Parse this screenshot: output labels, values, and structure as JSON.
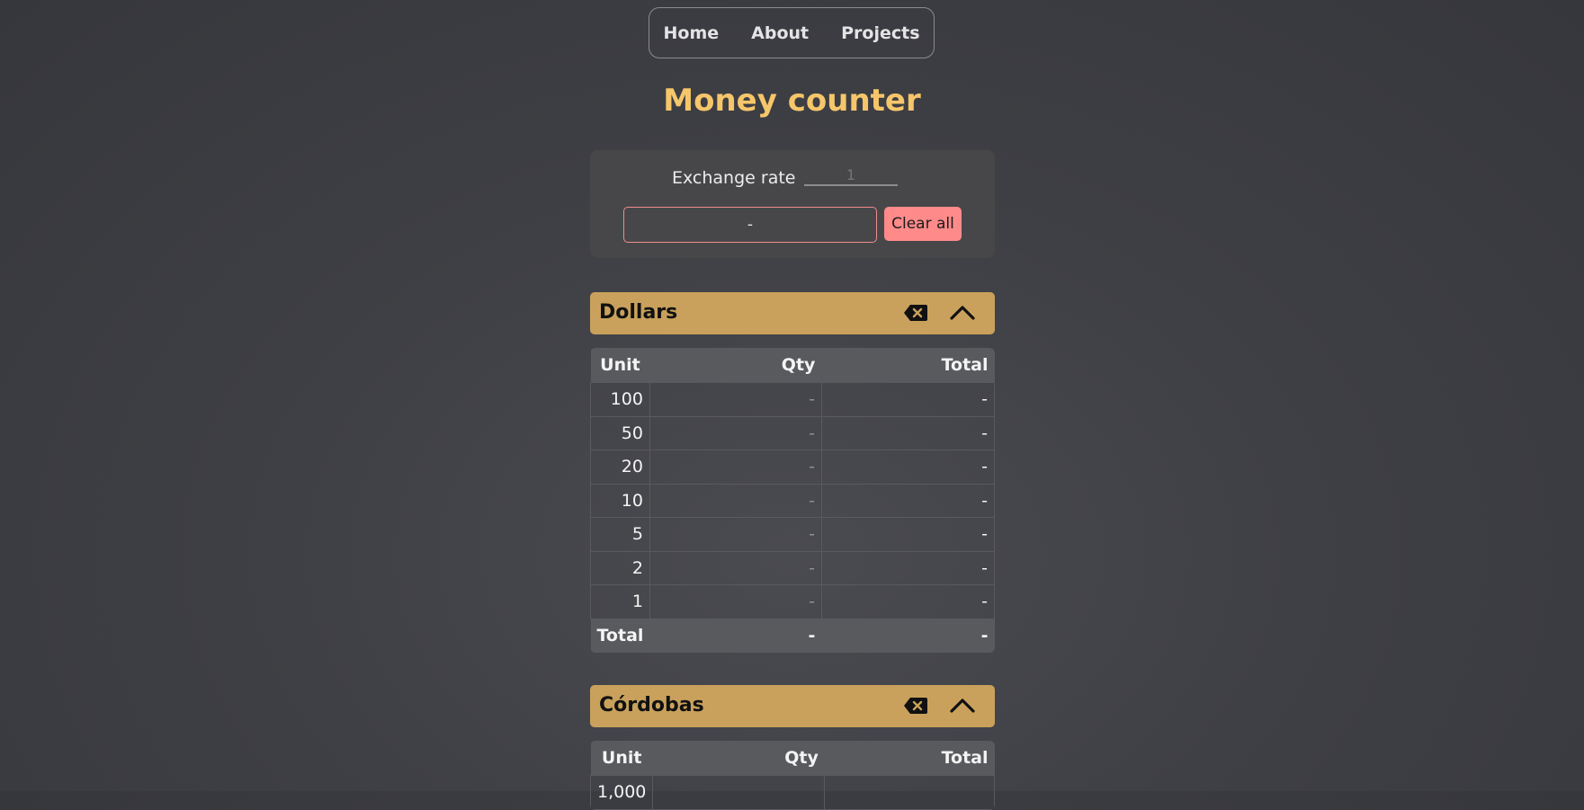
{
  "nav": {
    "items": [
      "Home",
      "About",
      "Projects"
    ]
  },
  "title": "Money counter",
  "exchange": {
    "label": "Exchange rate",
    "value": "1"
  },
  "grand_total": "-",
  "clear_all_label": "Clear all",
  "icons": {
    "clear_section": "backspace-clear-icon",
    "collapse": "chevron-up-icon"
  },
  "colors": {
    "accent": "#f6c66a",
    "section": "#c9a15c",
    "danger": "#ff8a8a"
  },
  "sections": [
    {
      "name": "Dollars",
      "headers": [
        "Unit",
        "Qty",
        "Total"
      ],
      "rows": [
        {
          "unit": "100",
          "qty": "-",
          "total": "-"
        },
        {
          "unit": "50",
          "qty": "-",
          "total": "-"
        },
        {
          "unit": "20",
          "qty": "-",
          "total": "-"
        },
        {
          "unit": "10",
          "qty": "-",
          "total": "-"
        },
        {
          "unit": "5",
          "qty": "-",
          "total": "-"
        },
        {
          "unit": "2",
          "qty": "-",
          "total": "-"
        },
        {
          "unit": "1",
          "qty": "-",
          "total": "-"
        }
      ],
      "footer": {
        "label": "Total",
        "qty": "-",
        "total": "-"
      }
    },
    {
      "name": "Córdobas",
      "headers": [
        "Unit",
        "Qty",
        "Total"
      ],
      "rows": [
        {
          "unit": "1,000",
          "qty": "",
          "total": ""
        }
      ]
    }
  ]
}
